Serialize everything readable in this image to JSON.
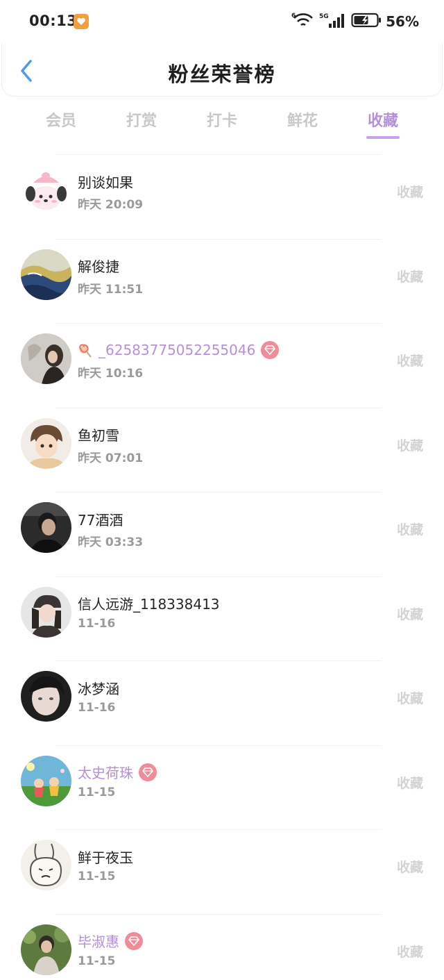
{
  "status": {
    "time": "00:13",
    "battery": "56%",
    "network": "5G"
  },
  "header": {
    "title": "粉丝荣誉榜"
  },
  "tabs": [
    {
      "label": "会员",
      "active": false
    },
    {
      "label": "打赏",
      "active": false
    },
    {
      "label": "打卡",
      "active": false
    },
    {
      "label": "鲜花",
      "active": false
    },
    {
      "label": "收藏",
      "active": true
    }
  ],
  "colors": {
    "accent": "#b58fd9",
    "badge": "#f08c98",
    "muted": "#c8c8c8"
  },
  "fans": [
    {
      "name": "别谈如果",
      "time": "昨天 20:09",
      "action": "收藏",
      "vip": false,
      "avatar": "cartoon-dog"
    },
    {
      "name": "解俊捷",
      "time": "昨天 11:51",
      "action": "收藏",
      "vip": false,
      "avatar": "ocean-wave"
    },
    {
      "name": "_62583775052255046",
      "time": "昨天 10:16",
      "action": "收藏",
      "vip": true,
      "prefix_icon": "lollipop-icon",
      "avatar": "girl-silhouette"
    },
    {
      "name": "鱼初雪",
      "time": "昨天 07:01",
      "action": "收藏",
      "vip": false,
      "avatar": "anime-boy"
    },
    {
      "name": "77酒酒",
      "time": "昨天 03:33",
      "action": "收藏",
      "vip": false,
      "avatar": "dark-portrait"
    },
    {
      "name": "信人远游_118338413",
      "time": "11-16",
      "action": "收藏",
      "vip": false,
      "avatar": "girl-hat"
    },
    {
      "name": "冰梦涵",
      "time": "11-16",
      "action": "收藏",
      "vip": false,
      "avatar": "blurry-face"
    },
    {
      "name": "太史荷珠",
      "time": "11-15",
      "action": "收藏",
      "vip": true,
      "avatar": "cartoon-kids"
    },
    {
      "name": "鲜于夜玉",
      "time": "11-15",
      "action": "收藏",
      "vip": false,
      "avatar": "bunny-sketch"
    },
    {
      "name": "毕淑惠",
      "time": "11-15",
      "action": "收藏",
      "vip": true,
      "avatar": "boy-outdoor"
    }
  ]
}
